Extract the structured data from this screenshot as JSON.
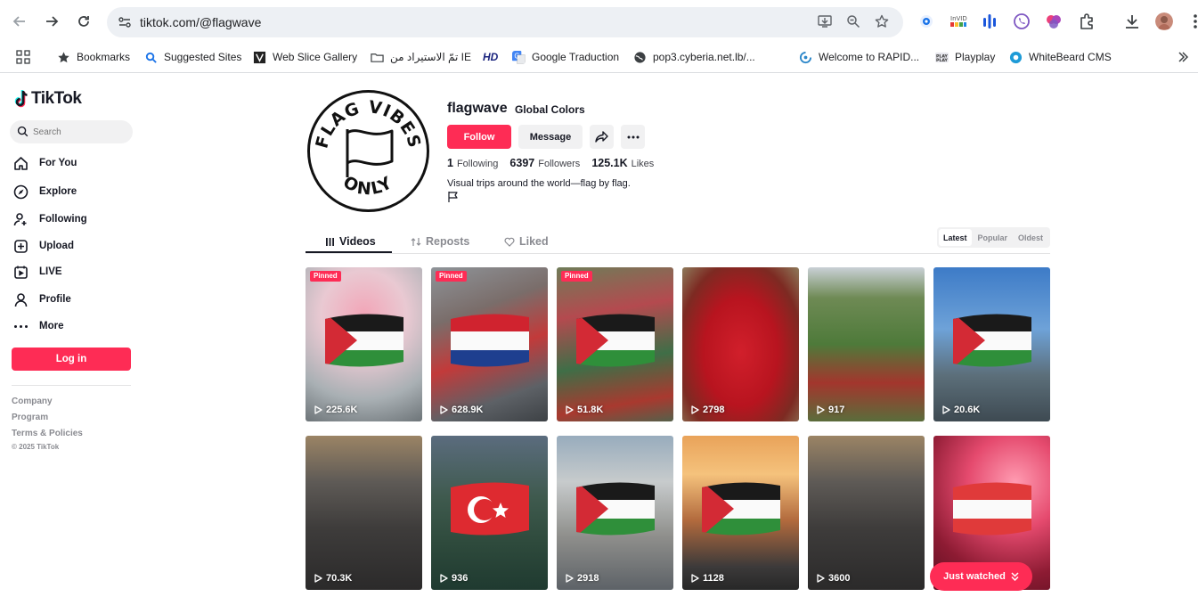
{
  "browser": {
    "url": "tiktok.com/@flagwave",
    "bookmarks": [
      {
        "label": "Bookmarks",
        "icon": "star-icon"
      },
      {
        "label": "Suggested Sites",
        "icon": "suggested-icon"
      },
      {
        "label": "Web Slice Gallery",
        "icon": "webslice-icon"
      },
      {
        "label": "تمّ الاستيراد من IE",
        "icon": "folder-icon"
      },
      {
        "label": "",
        "icon": "hd-icon"
      },
      {
        "label": "Google Traduction",
        "icon": "translate-icon"
      },
      {
        "label": "pop3.cyberia.net.lb/...",
        "icon": "globe-icon"
      },
      {
        "label": "Welcome to RAPID...",
        "icon": "rapid-icon"
      },
      {
        "label": "Playplay",
        "icon": "playplay-icon"
      },
      {
        "label": "WhiteBeard CMS",
        "icon": "whitebeard-icon"
      }
    ],
    "hd_label": "HD"
  },
  "sidebar": {
    "brand": "TikTok",
    "search_placeholder": "Search",
    "nav": [
      {
        "label": "For You",
        "icon": "home-icon"
      },
      {
        "label": "Explore",
        "icon": "compass-icon"
      },
      {
        "label": "Following",
        "icon": "following-icon"
      },
      {
        "label": "Upload",
        "icon": "upload-icon"
      },
      {
        "label": "LIVE",
        "icon": "live-icon"
      },
      {
        "label": "Profile",
        "icon": "profile-icon"
      },
      {
        "label": "More",
        "icon": "more-icon"
      }
    ],
    "login_label": "Log in",
    "footer_links": [
      "Company",
      "Program",
      "Terms & Policies"
    ],
    "copyright": "© 2025 TikTok"
  },
  "profile": {
    "avatar_text_top": "FLAG VIBES",
    "avatar_text_bottom": "ONLY",
    "username": "flagwave",
    "nickname": "Global Colors",
    "follow_label": "Follow",
    "message_label": "Message",
    "following_count": "1",
    "following_label": "Following",
    "followers_count": "6397",
    "followers_label": "Followers",
    "likes_count": "125.1K",
    "likes_label": "Likes",
    "bio": "Visual trips around the world—flag by flag."
  },
  "tabs": [
    {
      "label": "Videos",
      "icon": "grid-icon",
      "active": true
    },
    {
      "label": "Reposts",
      "icon": "repost-icon",
      "active": false
    },
    {
      "label": "Liked",
      "icon": "heart-outline-icon",
      "active": false
    }
  ],
  "sort": [
    {
      "label": "Latest",
      "active": true
    },
    {
      "label": "Popular",
      "active": false
    },
    {
      "label": "Oldest",
      "active": false
    }
  ],
  "videos": [
    {
      "views": "225.6K",
      "pinned": "Pinned",
      "flag": "palestine"
    },
    {
      "views": "628.9K",
      "pinned": "Pinned",
      "flag": "netherlands"
    },
    {
      "views": "51.8K",
      "pinned": "Pinned",
      "flag": "palestine"
    },
    {
      "views": "2798",
      "pinned": "",
      "flag": "none"
    },
    {
      "views": "917",
      "pinned": "",
      "flag": "none"
    },
    {
      "views": "20.6K",
      "pinned": "",
      "flag": "palestine"
    },
    {
      "views": "70.3K",
      "pinned": "",
      "flag": "none"
    },
    {
      "views": "936",
      "pinned": "",
      "flag": "turkey"
    },
    {
      "views": "2918",
      "pinned": "",
      "flag": "palestine"
    },
    {
      "views": "1128",
      "pinned": "",
      "flag": "palestine"
    },
    {
      "views": "3600",
      "pinned": "",
      "flag": "none"
    },
    {
      "views": "",
      "pinned": "",
      "flag": "austria"
    }
  ],
  "just_watched_label": "Just watched",
  "colors": {
    "accent": "#fe2c55",
    "text": "#161823",
    "muted": "#8a8b91"
  }
}
